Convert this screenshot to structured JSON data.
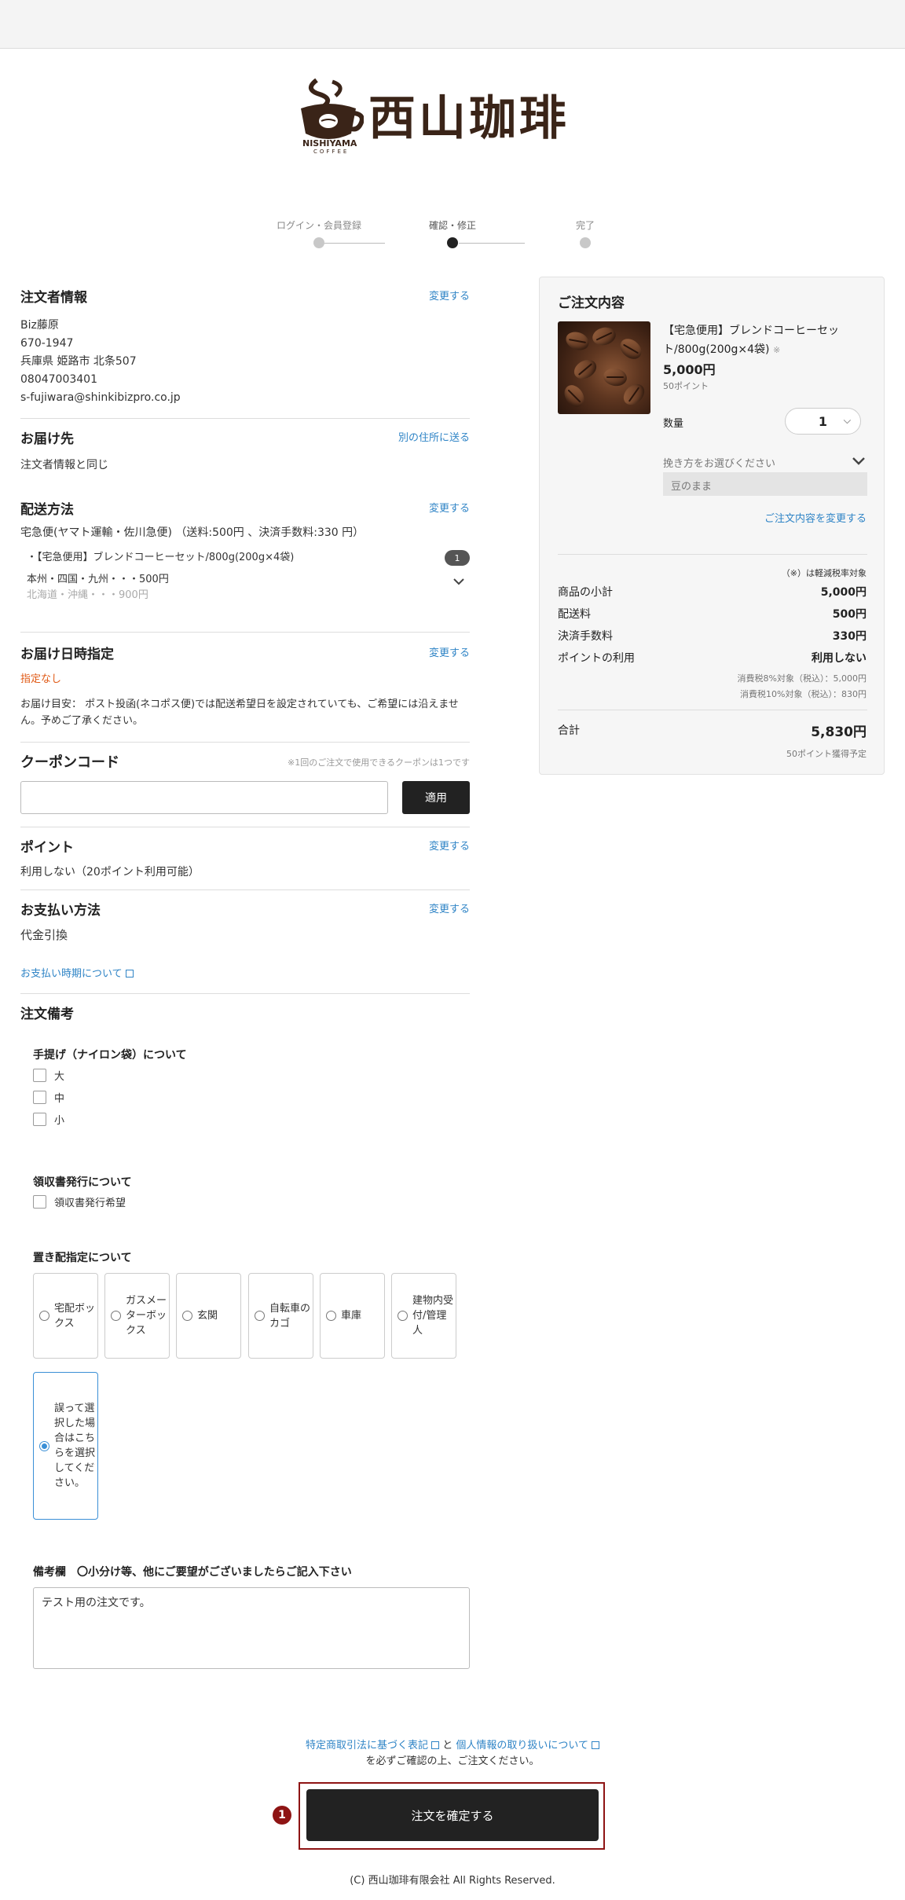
{
  "logo": {
    "text": "西山珈琲",
    "sub": "NISHIYAMA",
    "sub2": "COFFEE"
  },
  "steps": [
    {
      "label": "ログイン・会員登録",
      "active": false
    },
    {
      "label": "確認・修正",
      "active": true
    },
    {
      "label": "完了",
      "active": false
    }
  ],
  "customer": {
    "title": "注文者情報",
    "change": "変更する",
    "lines": [
      "Biz藤原",
      "670-1947",
      "兵庫県 姫路市 北条507",
      "08047003401",
      "s-fujiwara@shinkibizpro.co.jp"
    ]
  },
  "delivery_to": {
    "title": "お届け先",
    "link": "別の住所に送る",
    "text": "注文者情報と同じ"
  },
  "shipping": {
    "title": "配送方法",
    "change": "変更する",
    "method": "宅急便(ヤマト運輸・佐川急便) （送料:500円 、決済手数料:330 円）",
    "item": "・【宅急便用】ブレンドコーヒーセット/800g(200g×4袋)",
    "item_count": "1",
    "rate_line1": "本州・四国・九州・・・500円",
    "rate_line2": "北海道・沖縄・・・900円"
  },
  "delivery_date": {
    "title": "お届け日時指定",
    "change": "変更する",
    "value": "指定なし",
    "note": "お届け目安： ポスト投函(ネコポス便)では配送希望日を設定されていても、ご希望には沿えません。予めご了承ください。"
  },
  "coupon": {
    "title": "クーポンコード",
    "note": "※1回のご注文で使用できるクーポンは1つです",
    "input_value": "",
    "button": "適用"
  },
  "points": {
    "title": "ポイント",
    "change": "変更する",
    "text": "利用しない（20ポイント利用可能）"
  },
  "payment": {
    "title": "お支払い方法",
    "change": "変更する",
    "method": "代金引換",
    "timing_link": "お支払い時期について"
  },
  "remarks": {
    "title": "注文備考",
    "bag_title": "手提げ（ナイロン袋）について",
    "bag_options": [
      "大",
      "中",
      "小"
    ],
    "receipt_title": "領収書発行について",
    "receipt_option": "領収書発行希望",
    "place_title": "置き配指定について",
    "place_options": [
      "宅配ボックス",
      "ガスメーターボックス",
      "玄関",
      "自転車のカゴ",
      "車庫",
      "建物内受付/管理人"
    ],
    "place_selected": "誤って選択した場合はこちらを選択してください。",
    "notes_label": "備考欄　〇小分け等、他にご要望がございましたらご記入下さい",
    "notes_value": "テスト用の注文です。"
  },
  "summary": {
    "title": "ご注文内容",
    "product_name": "【宅急便用】ブレンドコーヒーセット/800g(200g×4袋)",
    "product_mark": "※",
    "price": "5,000円",
    "points": "50ポイント",
    "qty_label": "数量",
    "qty_value": "1",
    "grind_label": "挽き方をお選びください",
    "grind_value": "豆のまま",
    "change_link": "ご注文内容を変更する",
    "reduced_note": "（※）は軽減税率対象",
    "rows": [
      {
        "label": "商品の小計",
        "value": "5,000円"
      },
      {
        "label": "配送料",
        "value": "500円"
      },
      {
        "label": "決済手数料",
        "value": "330円"
      },
      {
        "label": "ポイントの利用",
        "value": "利用しない"
      }
    ],
    "tax8": "消費税8%対象（税込）：5,000円",
    "tax10": "消費税10%対象（税込）：830円",
    "total_label": "合計",
    "total_value": "5,830円",
    "earn": "50ポイント獲得予定"
  },
  "legal": {
    "link1": "特定商取引法に基づく表記",
    "and": " と ",
    "link2": "個人情報の取り扱いについて",
    "line2": "を必ずご確認の上、ご注文ください。"
  },
  "confirm": {
    "badge": "1",
    "label": "注文を確定する"
  },
  "footer": "(C) 西山珈琲有限会社 All Rights Reserved."
}
